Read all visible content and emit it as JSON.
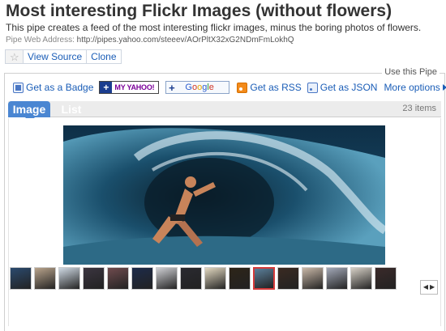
{
  "header": {
    "title": "Most interesting Flickr Images (without flowers)",
    "description": "This pipe creates a feed of the most interesting flickr images, minus the boring photos of flowers.",
    "address_label": "Pipe Web Address:",
    "address_value": "http://pipes.yahoo.com/steeev/AOrPltX32xG2NDmFmLokhQ"
  },
  "actions": {
    "star_icon": "star-icon",
    "view_source": "View Source",
    "clone": "Clone"
  },
  "use_pipe": {
    "label": "Use this Pipe",
    "get_badge": "Get as a Badge",
    "my_yahoo": "MY YAHOO!",
    "google": "Google",
    "get_rss": "Get as RSS",
    "get_json": "Get as JSON",
    "more_options": "More options"
  },
  "tabs": {
    "image": "Image",
    "list": "List",
    "count": "23 items"
  },
  "colors": {
    "link": "#1a5db7",
    "tab_active": "#4a86d2",
    "selected_thumb_border": "#d43a3a"
  }
}
